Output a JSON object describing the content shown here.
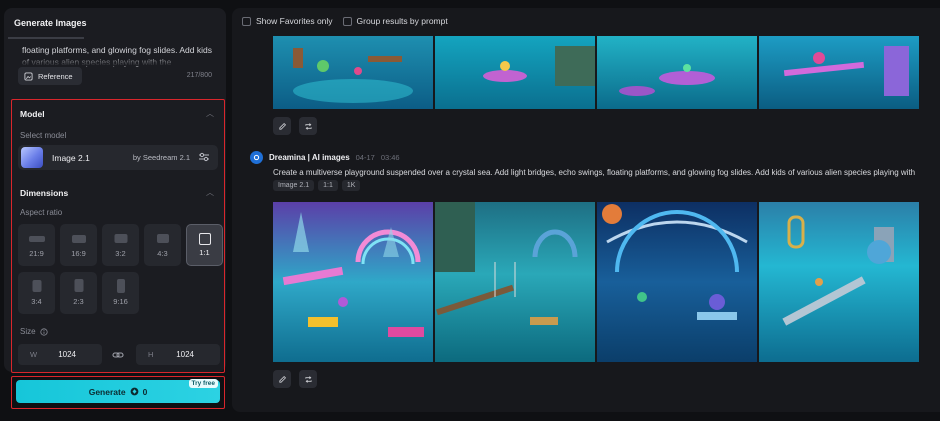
{
  "left_panel": {
    "tab": "Generate Images",
    "prompt_text": "floating platforms, and glowing fog slides. Add kids of various alien species playing with the",
    "reference_label": "Reference",
    "char_count": "217/800"
  },
  "model_section": {
    "title": "Model",
    "subtitle": "Select model",
    "model_name": "Image 2.1",
    "model_by": "by Seedream 2.1"
  },
  "dimensions": {
    "title": "Dimensions",
    "aspect_label": "Aspect ratio",
    "ratios": [
      "21:9",
      "16:9",
      "3:2",
      "4:3",
      "1:1",
      "3:4",
      "2:3",
      "9:16"
    ],
    "selected_ratio": "1:1",
    "size_label": "Size",
    "width_key": "W",
    "width_value": "1024",
    "height_key": "H",
    "height_value": "1024"
  },
  "generate": {
    "label": "Generate",
    "credits": "0",
    "badge": "Try free"
  },
  "filters": {
    "favorites": "Show Favorites only",
    "group": "Group results by prompt"
  },
  "result": {
    "author": "Dreamina | AI images",
    "date": "04-17",
    "time": "03:46",
    "prompt": "Create a multiverse playground suspended over a crystal sea. Add light bridges, echo swings, floating platforms, and glowing fog slides. Add kids of various alien species playing with",
    "tags": [
      "Image 2.1",
      "1:1",
      "1K"
    ]
  },
  "colors": {
    "accent": "#16c6d9",
    "highlight_border": "#d9262c",
    "panel_bg": "#1b1c21",
    "page_bg": "#0f1013"
  },
  "icons": {
    "reference": "image-reference-icon",
    "tune": "sliders-icon",
    "link": "link-icon",
    "edit": "pencil-icon",
    "remix": "repeat-icon",
    "credit": "credit-coin-icon",
    "info": "info-icon"
  }
}
